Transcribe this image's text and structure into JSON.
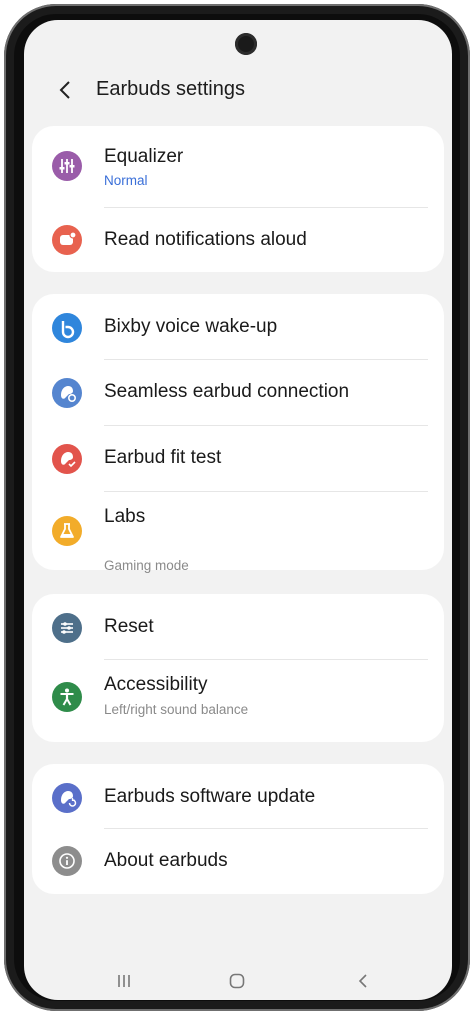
{
  "header": {
    "title": "Earbuds settings",
    "back_icon": "back-arrow-icon"
  },
  "groups": [
    {
      "items": [
        {
          "label": "Equalizer",
          "sub": "Normal",
          "sub_style": "blue",
          "icon": "equalizer-icon",
          "color": "#9a5ca9"
        },
        {
          "label": "Read notifications aloud",
          "sub": "",
          "icon": "notification-icon",
          "color": "#e8624f"
        }
      ]
    },
    {
      "items": [
        {
          "label": "Bixby voice wake-up",
          "sub": "",
          "icon": "bixby-icon",
          "color": "#2f86dc"
        },
        {
          "label": "Seamless earbud connection",
          "sub": "",
          "icon": "earbud-connection-icon",
          "color": "#5585cf"
        },
        {
          "label": "Earbud fit test",
          "sub": "",
          "icon": "fit-test-icon",
          "color": "#e2544c"
        },
        {
          "label": "Labs",
          "sub": "Gaming mode",
          "sub_style": "gray",
          "icon": "labs-flask-icon",
          "color": "#f2ac2a"
        }
      ]
    },
    {
      "items": [
        {
          "label": "Reset",
          "sub": "",
          "icon": "reset-icon",
          "color": "#4e6f8a"
        },
        {
          "label": "Accessibility",
          "sub": "Left/right sound balance",
          "sub_style": "gray",
          "icon": "accessibility-icon",
          "color": "#2f8c4a"
        }
      ]
    },
    {
      "items": [
        {
          "label": "Earbuds software update",
          "sub": "",
          "icon": "software-update-icon",
          "color": "#5a6fc9"
        },
        {
          "label": "About earbuds",
          "sub": "",
          "icon": "info-icon",
          "color": "#8d8d8d"
        }
      ]
    }
  ],
  "navbar": {
    "recents_icon": "recents-icon",
    "home_icon": "home-icon",
    "back_icon": "nav-back-icon"
  }
}
